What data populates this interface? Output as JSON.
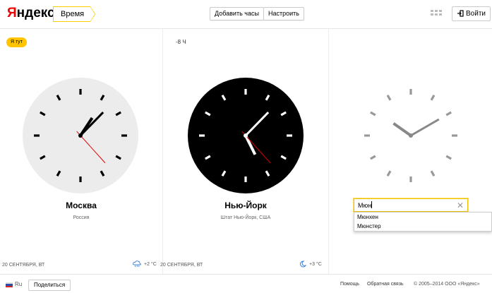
{
  "header": {
    "logo": "Яндекс",
    "logo_first": "Я",
    "logo_rest": "ндекс",
    "service": "Время",
    "add_clock": "Добавить часы",
    "settings": "Настроить",
    "login": "Войти"
  },
  "clocks": [
    {
      "badge": "Я тут",
      "city": "Москва",
      "country": "Россия",
      "date": "20 СЕНТЯБРЯ, ВТ",
      "temp": "+2 °C",
      "weather_icon": "cloud-rain-icon",
      "face": "light",
      "time": {
        "hour": 1,
        "minute": 7,
        "second": 23
      }
    },
    {
      "offset": "-8 Ч",
      "city": "Нью-Йорк",
      "country": "Штат Нью-Йорк, США",
      "date": "20 СЕНТЯБРЯ, ВТ",
      "temp": "+3 °C",
      "weather_icon": "moon-icon",
      "face": "dark",
      "time": {
        "hour": 5,
        "minute": 7,
        "second": 23
      }
    },
    {
      "face": "empty",
      "time": {
        "hour": 10,
        "minute": 10,
        "second": 0
      },
      "search_value": "Мюн",
      "suggestions": [
        "Мюнхен",
        "Мюнстер"
      ]
    }
  ],
  "footer": {
    "lang": "Ru",
    "share": "Поделиться",
    "help": "Помощь",
    "feedback": "Обратная связь",
    "copyright": "© 2005–2014  ООО «Яндекс»"
  },
  "colors": {
    "accent": "#ffcc00",
    "second_hand": "#e00000",
    "logo_red": "#ee0000"
  }
}
